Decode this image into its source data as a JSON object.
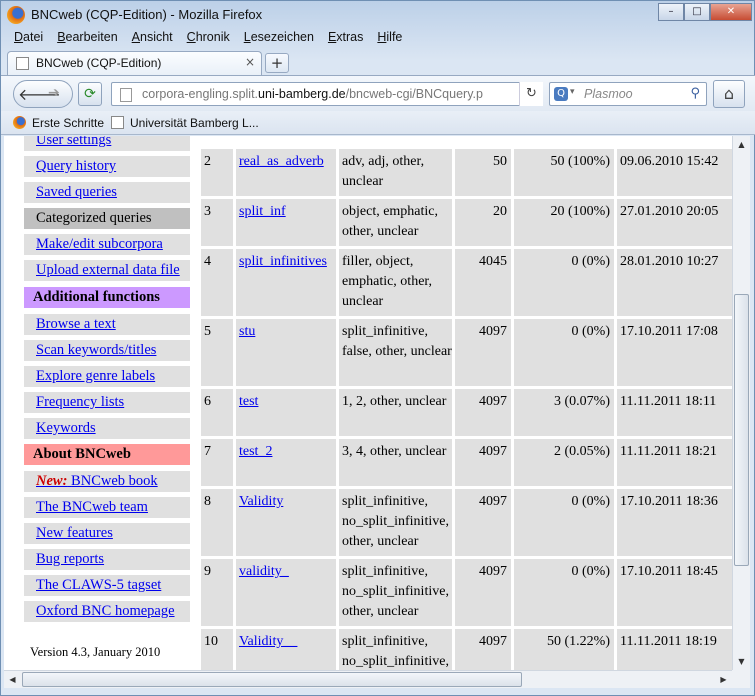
{
  "window": {
    "title": "BNCweb (CQP-Edition) - Mozilla Firefox",
    "min": "–",
    "max": "□",
    "close": "✕"
  },
  "menu": [
    {
      "label": "Datei",
      "u": "D",
      "rest": "atei"
    },
    {
      "label": "Bearbeiten",
      "u": "B",
      "rest": "earbeiten"
    },
    {
      "label": "Ansicht",
      "u": "A",
      "rest": "nsicht"
    },
    {
      "label": "Chronik",
      "u": "C",
      "rest": "hronik"
    },
    {
      "label": "Lesezeichen",
      "u": "L",
      "rest": "esezeichen"
    },
    {
      "label": "Extras",
      "u": "E",
      "rest": "xtras"
    },
    {
      "label": "Hilfe",
      "u": "H",
      "rest": "ilfe"
    }
  ],
  "tab": {
    "title": "BNCweb (CQP-Edition)",
    "close": "×",
    "new": "+"
  },
  "nav": {
    "url_pre": "corpora-engling.split.",
    "url_host": "uni-bamberg.de",
    "url_post": "/bncweb-cgi/BNCquery.p",
    "search_placeholder": "Plasmoo"
  },
  "bookmarks": [
    "Erste Schritte",
    "Universität Bamberg L..."
  ],
  "sidebar": {
    "user_settings": "User settings",
    "query_history": "Query history",
    "saved_queries": "Saved queries",
    "categorized_queries": "Categorized queries",
    "make_edit_subcorpora": "Make/edit subcorpora",
    "upload_external": "Upload external data file",
    "additional_functions": "Additional functions",
    "browse_text": "Browse a text",
    "scan_keywords": "Scan keywords/titles",
    "explore_genre": "Explore genre labels",
    "frequency_lists": "Frequency lists",
    "keywords": "Keywords",
    "about": "About BNCweb",
    "new_label": "New:",
    "bncweb_book": "BNCweb book",
    "team": "The BNCweb team",
    "new_features": "New features",
    "bug_reports": "Bug reports",
    "claws": "The CLAWS-5 tagset",
    "oxford": "Oxford BNC homepage",
    "version": "Version 4.3, January 2010"
  },
  "rows": [
    {
      "num": "2",
      "name": "real_as_adverb",
      "cats": "adv, adj, other, unclear",
      "hits": "50",
      "cat": "50 (100%)",
      "date": "09.06.2010 15:42"
    },
    {
      "num": "3",
      "name": "split_inf",
      "cats": "object, emphatic, other, unclear",
      "hits": "20",
      "cat": "20 (100%)",
      "date": "27.01.2010 20:05"
    },
    {
      "num": "4",
      "name": "split_infinitives",
      "cats": "filler, object, emphatic, other, unclear",
      "hits": "4045",
      "cat": "0 (0%)",
      "date": "28.01.2010 10:27"
    },
    {
      "num": "5",
      "name": "stu",
      "cats": "split_infinitive, false, other, unclear",
      "hits": "4097",
      "cat": "0 (0%)",
      "date": "17.10.2011 17:08"
    },
    {
      "num": "6",
      "name": "test",
      "cats": "1, 2, other, unclear",
      "hits": "4097",
      "cat": "3 (0.07%)",
      "date": "11.11.2011 18:11"
    },
    {
      "num": "7",
      "name": "test_2",
      "cats": "3, 4, other, unclear",
      "hits": "4097",
      "cat": "2 (0.05%)",
      "date": "11.11.2011 18:21"
    },
    {
      "num": "8",
      "name": "Validity",
      "cats": "split_infinitive, no_split_infinitive, other, unclear",
      "hits": "4097",
      "cat": "0 (0%)",
      "date": "17.10.2011 18:36"
    },
    {
      "num": "9",
      "name": "validity_",
      "cats": "split_infinitive, no_split_infinitive, other, unclear",
      "hits": "4097",
      "cat": "0 (0%)",
      "date": "17.10.2011 18:45"
    },
    {
      "num": "10",
      "name": "Validity__",
      "cats": "split_infinitive, no_split_infinitive,",
      "hits": "4097",
      "cat": "50 (1.22%)",
      "date": "11.11.2011 18:19"
    }
  ]
}
